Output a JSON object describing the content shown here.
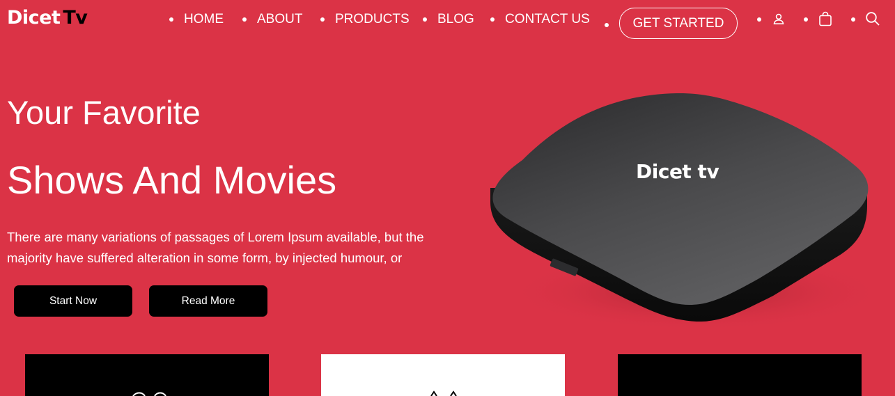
{
  "brand": {
    "part1": "Dicet",
    "part2": "Tv"
  },
  "nav": {
    "items": [
      "HOME",
      "ABOUT",
      "PRODUCTS",
      "BLOG",
      "CONTACT US"
    ],
    "cta_label": "GET STARTED",
    "icons": [
      "user-icon",
      "shopping-bag-icon",
      "search-icon"
    ]
  },
  "hero": {
    "title_line1": "Your Favorite",
    "title_line2": "Shows And Movies",
    "description": "There are many variations of passages of Lorem Ipsum available, but the majority have suffered alteration in some form, by injected humour, or",
    "primary_button": "Start Now",
    "secondary_button": "Read More",
    "device_label": "Dicet tv"
  },
  "cards": [
    {
      "background": "#000000"
    },
    {
      "background": "#ffffff"
    },
    {
      "background": "#000000"
    }
  ],
  "colors": {
    "background": "#db3346",
    "text": "#ffffff",
    "button": "#000000"
  }
}
